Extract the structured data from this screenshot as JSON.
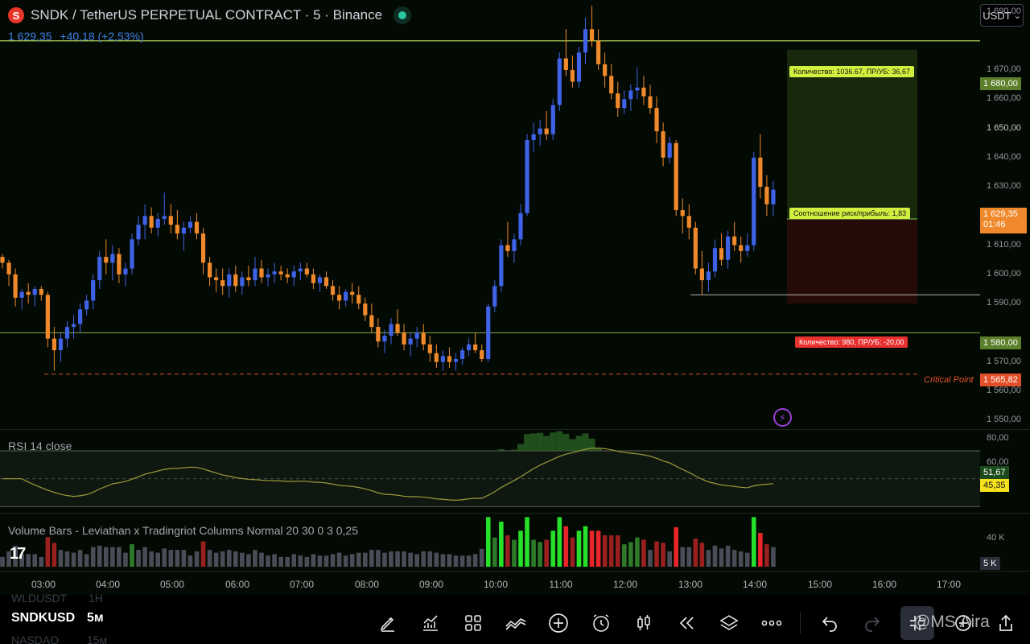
{
  "header": {
    "title": "SNDK / TetherUS PERPETUAL CONTRACT · 5 · Binance",
    "logo_glyph": "S",
    "last_price": "1 629,35",
    "change": "+40,18 (+2,53%)",
    "currency": "USDT",
    "currency_caret": "⌄"
  },
  "price_axis": {
    "labels": [
      "1 690,00",
      "1 670,00",
      "1 660,00",
      "1 650,00",
      "1 640,00",
      "1 630,00",
      "1 620,00",
      "1 610,00",
      "1 600,00",
      "1 590,00",
      "1 570,00",
      "1 560,00",
      "1 550,00"
    ],
    "tag_tp": "1 680,00",
    "tag_current": "1 629,35",
    "tag_countdown": "01:46",
    "tag_sl": "1 580,00",
    "tag_critical": "1 565,82"
  },
  "annotations": {
    "tp_callout": "Количество: 1036.67, ПР/УБ: 36,67",
    "rr_callout": "Соотношение риск/прибыль: 1,83",
    "sl_callout": "Количество: 980, ПР/УБ: -20,00",
    "critical_label": "Critical Point",
    "alert_glyph": "⚡"
  },
  "rsi": {
    "title": "RSI 14 close",
    "axis_labels": [
      "80,00",
      "60,00"
    ],
    "tag_rsi": "51,67",
    "tag_ma": "45,35"
  },
  "volume": {
    "title": "Volume Bars - Leviathan x Tradingriot Columns Normal 20 30 0 3 0,25",
    "axis_label": "40 K",
    "tag": "5 K",
    "tv_logo": "17"
  },
  "time_axis": {
    "labels": [
      "03:00",
      "04:00",
      "05:00",
      "06:00",
      "07:00",
      "08:00",
      "09:00",
      "10:00",
      "11:00",
      "12:00",
      "13:00",
      "14:00",
      "15:00",
      "16:00",
      "17:00"
    ]
  },
  "bottom": {
    "symbol": "SNDKUSD",
    "interval": "5м",
    "ghost_symbol_top": "WLDUSDT",
    "ghost_interval_top": "1Н",
    "ghost_symbol_bottom": "NASDAQ",
    "ghost_interval_bottom": "15м",
    "watermark": "@MS Aira",
    "colors": {
      "bull": "#3f62e6",
      "bear": "#f0892b",
      "tp": "#b5d95a",
      "sl": "#e8312f",
      "rsi": "#4a8f3b"
    }
  },
  "chart_data": {
    "type": "candlestick",
    "price_range": [
      1547,
      1694
    ],
    "candles": [
      [
        1606,
        1607,
        1602,
        1604
      ],
      [
        1604,
        1605,
        1596,
        1600
      ],
      [
        1600,
        1602,
        1589,
        1592
      ],
      [
        1592,
        1595,
        1588,
        1594
      ],
      [
        1594,
        1597,
        1590,
        1593
      ],
      [
        1593,
        1596,
        1589,
        1595
      ],
      [
        1595,
        1596,
        1591,
        1593
      ],
      [
        1593,
        1594,
        1575,
        1578
      ],
      [
        1578,
        1582,
        1567,
        1574
      ],
      [
        1574,
        1580,
        1570,
        1578
      ],
      [
        1578,
        1584,
        1575,
        1582
      ],
      [
        1582,
        1586,
        1578,
        1583
      ],
      [
        1583,
        1590,
        1580,
        1588
      ],
      [
        1588,
        1593,
        1586,
        1591
      ],
      [
        1591,
        1600,
        1588,
        1598
      ],
      [
        1598,
        1608,
        1595,
        1606
      ],
      [
        1606,
        1612,
        1600,
        1604
      ],
      [
        1604,
        1610,
        1598,
        1607
      ],
      [
        1607,
        1609,
        1597,
        1600
      ],
      [
        1600,
        1604,
        1596,
        1602
      ],
      [
        1602,
        1614,
        1600,
        1612
      ],
      [
        1612,
        1620,
        1610,
        1617
      ],
      [
        1617,
        1624,
        1612,
        1620
      ],
      [
        1620,
        1623,
        1614,
        1616
      ],
      [
        1616,
        1621,
        1613,
        1619
      ],
      [
        1619,
        1628,
        1617,
        1620
      ],
      [
        1620,
        1624,
        1614,
        1617
      ],
      [
        1617,
        1622,
        1612,
        1614
      ],
      [
        1614,
        1618,
        1608,
        1616
      ],
      [
        1616,
        1620,
        1614,
        1618
      ],
      [
        1618,
        1621,
        1612,
        1614
      ],
      [
        1614,
        1616,
        1600,
        1604
      ],
      [
        1604,
        1606,
        1596,
        1599
      ],
      [
        1599,
        1602,
        1594,
        1598
      ],
      [
        1598,
        1602,
        1593,
        1596
      ],
      [
        1596,
        1602,
        1592,
        1600
      ],
      [
        1600,
        1603,
        1594,
        1596
      ],
      [
        1596,
        1601,
        1593,
        1599
      ],
      [
        1599,
        1603,
        1596,
        1598
      ],
      [
        1598,
        1606,
        1596,
        1602
      ],
      [
        1602,
        1605,
        1597,
        1599
      ],
      [
        1599,
        1602,
        1596,
        1600
      ],
      [
        1600,
        1604,
        1597,
        1601
      ],
      [
        1601,
        1603,
        1598,
        1600
      ],
      [
        1600,
        1602,
        1597,
        1599
      ],
      [
        1599,
        1603,
        1596,
        1601
      ],
      [
        1601,
        1604,
        1598,
        1602
      ],
      [
        1602,
        1604,
        1599,
        1600
      ],
      [
        1600,
        1602,
        1595,
        1597
      ],
      [
        1597,
        1600,
        1594,
        1599
      ],
      [
        1599,
        1601,
        1595,
        1596
      ],
      [
        1596,
        1598,
        1591,
        1593
      ],
      [
        1593,
        1596,
        1588,
        1591
      ],
      [
        1591,
        1595,
        1589,
        1594
      ],
      [
        1594,
        1597,
        1590,
        1593
      ],
      [
        1593,
        1596,
        1588,
        1590
      ],
      [
        1590,
        1592,
        1584,
        1586
      ],
      [
        1586,
        1590,
        1580,
        1582
      ],
      [
        1582,
        1585,
        1575,
        1577
      ],
      [
        1577,
        1581,
        1573,
        1579
      ],
      [
        1579,
        1585,
        1576,
        1583
      ],
      [
        1583,
        1588,
        1579,
        1580
      ],
      [
        1580,
        1583,
        1574,
        1576
      ],
      [
        1576,
        1580,
        1572,
        1578
      ],
      [
        1578,
        1582,
        1575,
        1580
      ],
      [
        1580,
        1583,
        1574,
        1576
      ],
      [
        1576,
        1579,
        1570,
        1573
      ],
      [
        1573,
        1576,
        1568,
        1570
      ],
      [
        1570,
        1574,
        1567,
        1572
      ],
      [
        1572,
        1575,
        1568,
        1570
      ],
      [
        1570,
        1573,
        1567,
        1571
      ],
      [
        1571,
        1575,
        1569,
        1574
      ],
      [
        1574,
        1578,
        1572,
        1576
      ],
      [
        1576,
        1580,
        1573,
        1574
      ],
      [
        1574,
        1576,
        1570,
        1571
      ],
      [
        1571,
        1590,
        1570,
        1589
      ],
      [
        1589,
        1598,
        1587,
        1596
      ],
      [
        1596,
        1612,
        1594,
        1610
      ],
      [
        1610,
        1618,
        1606,
        1608
      ],
      [
        1608,
        1614,
        1604,
        1612
      ],
      [
        1612,
        1624,
        1610,
        1621
      ],
      [
        1621,
        1648,
        1620,
        1646
      ],
      [
        1646,
        1652,
        1642,
        1648
      ],
      [
        1648,
        1653,
        1644,
        1650
      ],
      [
        1650,
        1656,
        1646,
        1648
      ],
      [
        1648,
        1660,
        1646,
        1658
      ],
      [
        1658,
        1676,
        1656,
        1674
      ],
      [
        1674,
        1684,
        1668,
        1670
      ],
      [
        1670,
        1675,
        1664,
        1666
      ],
      [
        1666,
        1678,
        1664,
        1676
      ],
      [
        1676,
        1688,
        1672,
        1684
      ],
      [
        1684,
        1692,
        1678,
        1680
      ],
      [
        1680,
        1684,
        1670,
        1672
      ],
      [
        1672,
        1676,
        1664,
        1668
      ],
      [
        1668,
        1672,
        1660,
        1662
      ],
      [
        1662,
        1666,
        1654,
        1657
      ],
      [
        1657,
        1663,
        1655,
        1660
      ],
      [
        1660,
        1665,
        1656,
        1663
      ],
      [
        1663,
        1671,
        1660,
        1664
      ],
      [
        1664,
        1668,
        1658,
        1661
      ],
      [
        1661,
        1665,
        1655,
        1657
      ],
      [
        1657,
        1661,
        1645,
        1649
      ],
      [
        1649,
        1652,
        1637,
        1640
      ],
      [
        1640,
        1647,
        1638,
        1645
      ],
      [
        1645,
        1646,
        1620,
        1622
      ],
      [
        1622,
        1626,
        1614,
        1620
      ],
      [
        1620,
        1624,
        1612,
        1616
      ],
      [
        1616,
        1618,
        1600,
        1602
      ],
      [
        1602,
        1608,
        1593,
        1598
      ],
      [
        1598,
        1604,
        1594,
        1601
      ],
      [
        1601,
        1612,
        1599,
        1609
      ],
      [
        1609,
        1614,
        1603,
        1605
      ],
      [
        1605,
        1615,
        1602,
        1613
      ],
      [
        1613,
        1618,
        1608,
        1610
      ],
      [
        1610,
        1613,
        1604,
        1608
      ],
      [
        1608,
        1614,
        1606,
        1610
      ],
      [
        1610,
        1642,
        1608,
        1640
      ],
      [
        1640,
        1648,
        1626,
        1630
      ],
      [
        1630,
        1634,
        1620,
        1624
      ],
      [
        1624,
        1632,
        1620,
        1629
      ]
    ],
    "tp_level": 1680,
    "sl_level": 1580,
    "entry_level": 1619,
    "critical_level": 1565.82,
    "low_level": 1593,
    "rsi": {
      "ylim": [
        25,
        85
      ],
      "upper": 70,
      "lower": 30,
      "mid": 50,
      "last_rsi": 51.67,
      "last_ma": 45.35
    },
    "volume_axis": {
      "ylim": [
        0,
        60000
      ]
    }
  }
}
